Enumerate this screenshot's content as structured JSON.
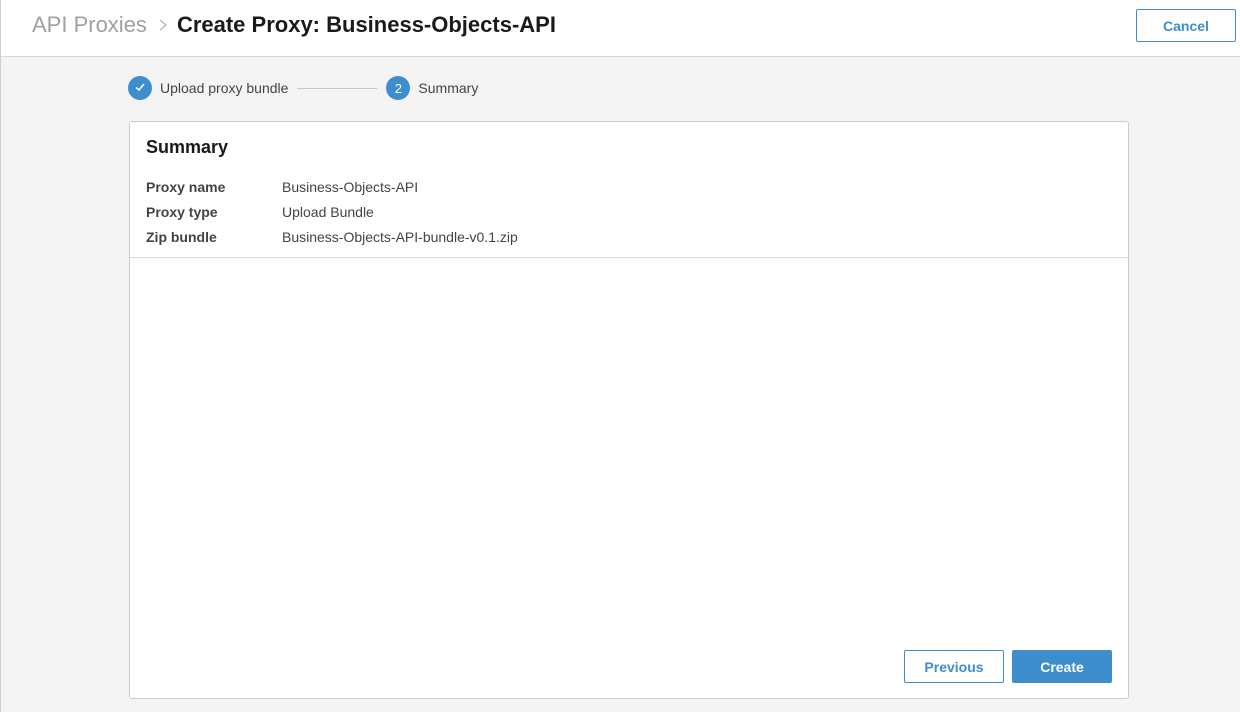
{
  "header": {
    "breadcrumb_link": "API Proxies",
    "title": "Create Proxy: Business-Objects-API",
    "cancel_label": "Cancel"
  },
  "stepper": {
    "steps": [
      {
        "number": "1",
        "label": "Upload proxy bundle",
        "state": "completed"
      },
      {
        "number": "2",
        "label": "Summary",
        "state": "current"
      }
    ]
  },
  "summary": {
    "title": "Summary",
    "rows": [
      {
        "key": "Proxy name",
        "value": "Business-Objects-API"
      },
      {
        "key": "Proxy type",
        "value": "Upload Bundle"
      },
      {
        "key": "Zip bundle",
        "value": "Business-Objects-API-bundle-v0.1.zip"
      }
    ]
  },
  "actions": {
    "previous_label": "Previous",
    "create_label": "Create"
  },
  "colors": {
    "accent": "#3e8ecd",
    "background": "#f4f4f4",
    "breadcrumb_muted": "#a0a0a0"
  },
  "icons": {
    "breadcrumb_separator": "chevron-right-icon",
    "completed_step": "check-icon"
  }
}
